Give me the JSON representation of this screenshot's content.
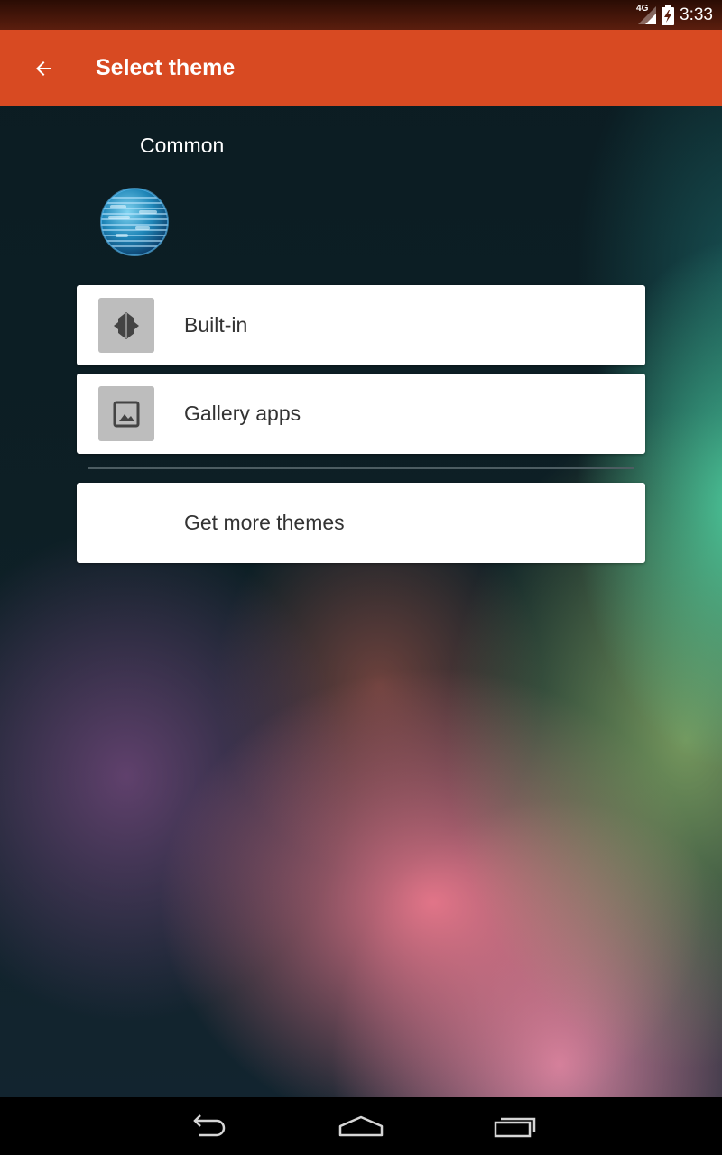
{
  "status_bar": {
    "network": "4G",
    "time": "3:33"
  },
  "app_bar": {
    "back_icon": "arrow-back-icon",
    "title": "Select theme",
    "color": "#d84a22"
  },
  "section": {
    "label": "Common",
    "icon": "globe-icon"
  },
  "items": [
    {
      "label": "Built-in",
      "icon": "built-in-theme-icon"
    },
    {
      "label": "Gallery apps",
      "icon": "image-icon"
    }
  ],
  "more": {
    "label": "Get more themes"
  },
  "nav_bar": {
    "back": "nav-back-icon",
    "home": "nav-home-icon",
    "recents": "nav-recents-icon"
  }
}
